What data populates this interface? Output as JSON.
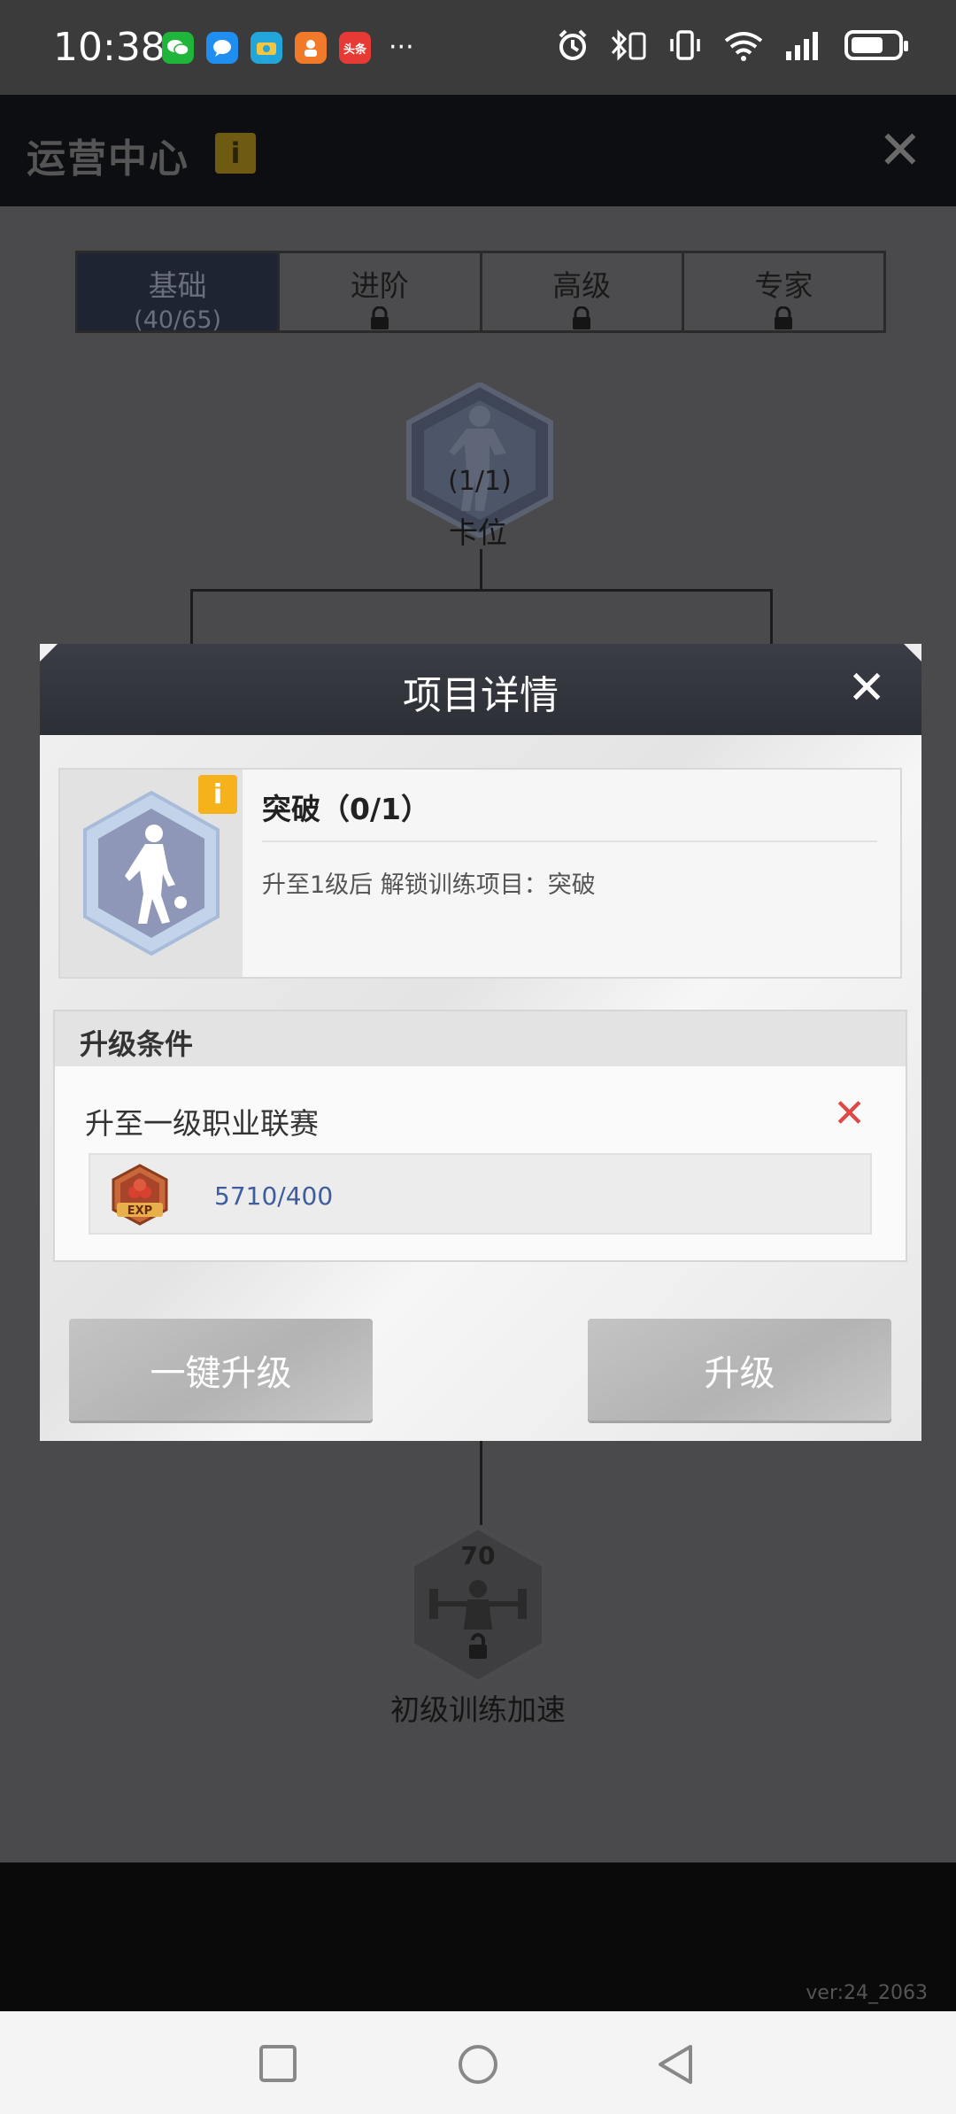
{
  "status_bar": {
    "time": "10:38",
    "app_icons": [
      "wechat-icon",
      "messages-icon",
      "weibo-camera-icon",
      "video-app-icon",
      "toutiao-icon"
    ],
    "toutiao_text": "头条",
    "more": "···"
  },
  "header": {
    "title": "运营中心",
    "info_label": "i",
    "close_label": "✕"
  },
  "tabs": [
    {
      "label": "基础",
      "sub": "(40/65)",
      "locked": false,
      "active": true
    },
    {
      "label": "进阶",
      "sub": "",
      "locked": true,
      "active": false
    },
    {
      "label": "高级",
      "sub": "",
      "locked": true,
      "active": false
    },
    {
      "label": "专家",
      "sub": "",
      "locked": true,
      "active": false
    }
  ],
  "tree": {
    "top_node_progress": "(1/1)",
    "top_node_label": "卡位",
    "bottom_node_level": "70",
    "bottom_node_label": "初级训练加速"
  },
  "modal": {
    "title": "项目详情",
    "close_label": "✕",
    "item": {
      "info_label": "i",
      "name": "突破（0/1）",
      "description": "升至1级后 解锁训练项目：突破"
    },
    "conditions": {
      "header": "升级条件",
      "requirement": "升至一级职业联赛",
      "status_mark": "✕",
      "exp_label": "EXP",
      "exp_value": "5710/400"
    },
    "buttons": {
      "one_click": "一键升级",
      "upgrade": "升级"
    }
  },
  "version": "ver:24_2063"
}
